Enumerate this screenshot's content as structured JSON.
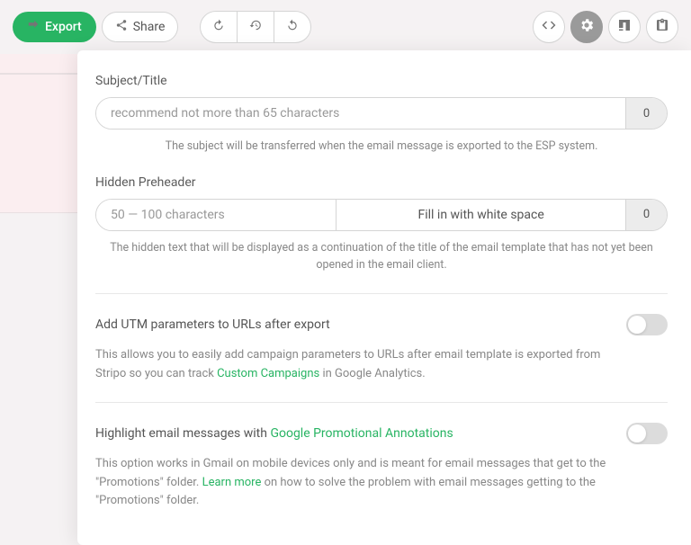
{
  "toolbar": {
    "export_label": "Export",
    "share_label": "Share"
  },
  "subject": {
    "label": "Subject/Title",
    "placeholder": "recommend not more than 65 characters",
    "counter": "0",
    "helper": "The subject will be transferred when the email message is exported to the ESP system."
  },
  "preheader": {
    "label": "Hidden Preheader",
    "placeholder": "50 — 100 characters",
    "fill_label": "Fill in with white space",
    "counter": "0",
    "helper": "The hidden text that will be displayed as a continuation of the title of the email template that has not yet been opened in the email client."
  },
  "utm": {
    "label": "Add UTM parameters to URLs after export",
    "desc_before": "This allows you to easily add campaign parameters to URLs after email template is exported from Stripo so you can track ",
    "link": "Custom Campaigns",
    "desc_after": " in Google Analytics."
  },
  "promo": {
    "label_before": "Highlight email messages with ",
    "label_link": "Google Promotional Annotations",
    "desc_before": "This option works in Gmail on mobile devices only and is meant for email messages that get to the \"Promotions\" folder. ",
    "link": "Learn more",
    "desc_after": " on how to solve the problem with email messages getting to the \"Promotions\" folder."
  }
}
